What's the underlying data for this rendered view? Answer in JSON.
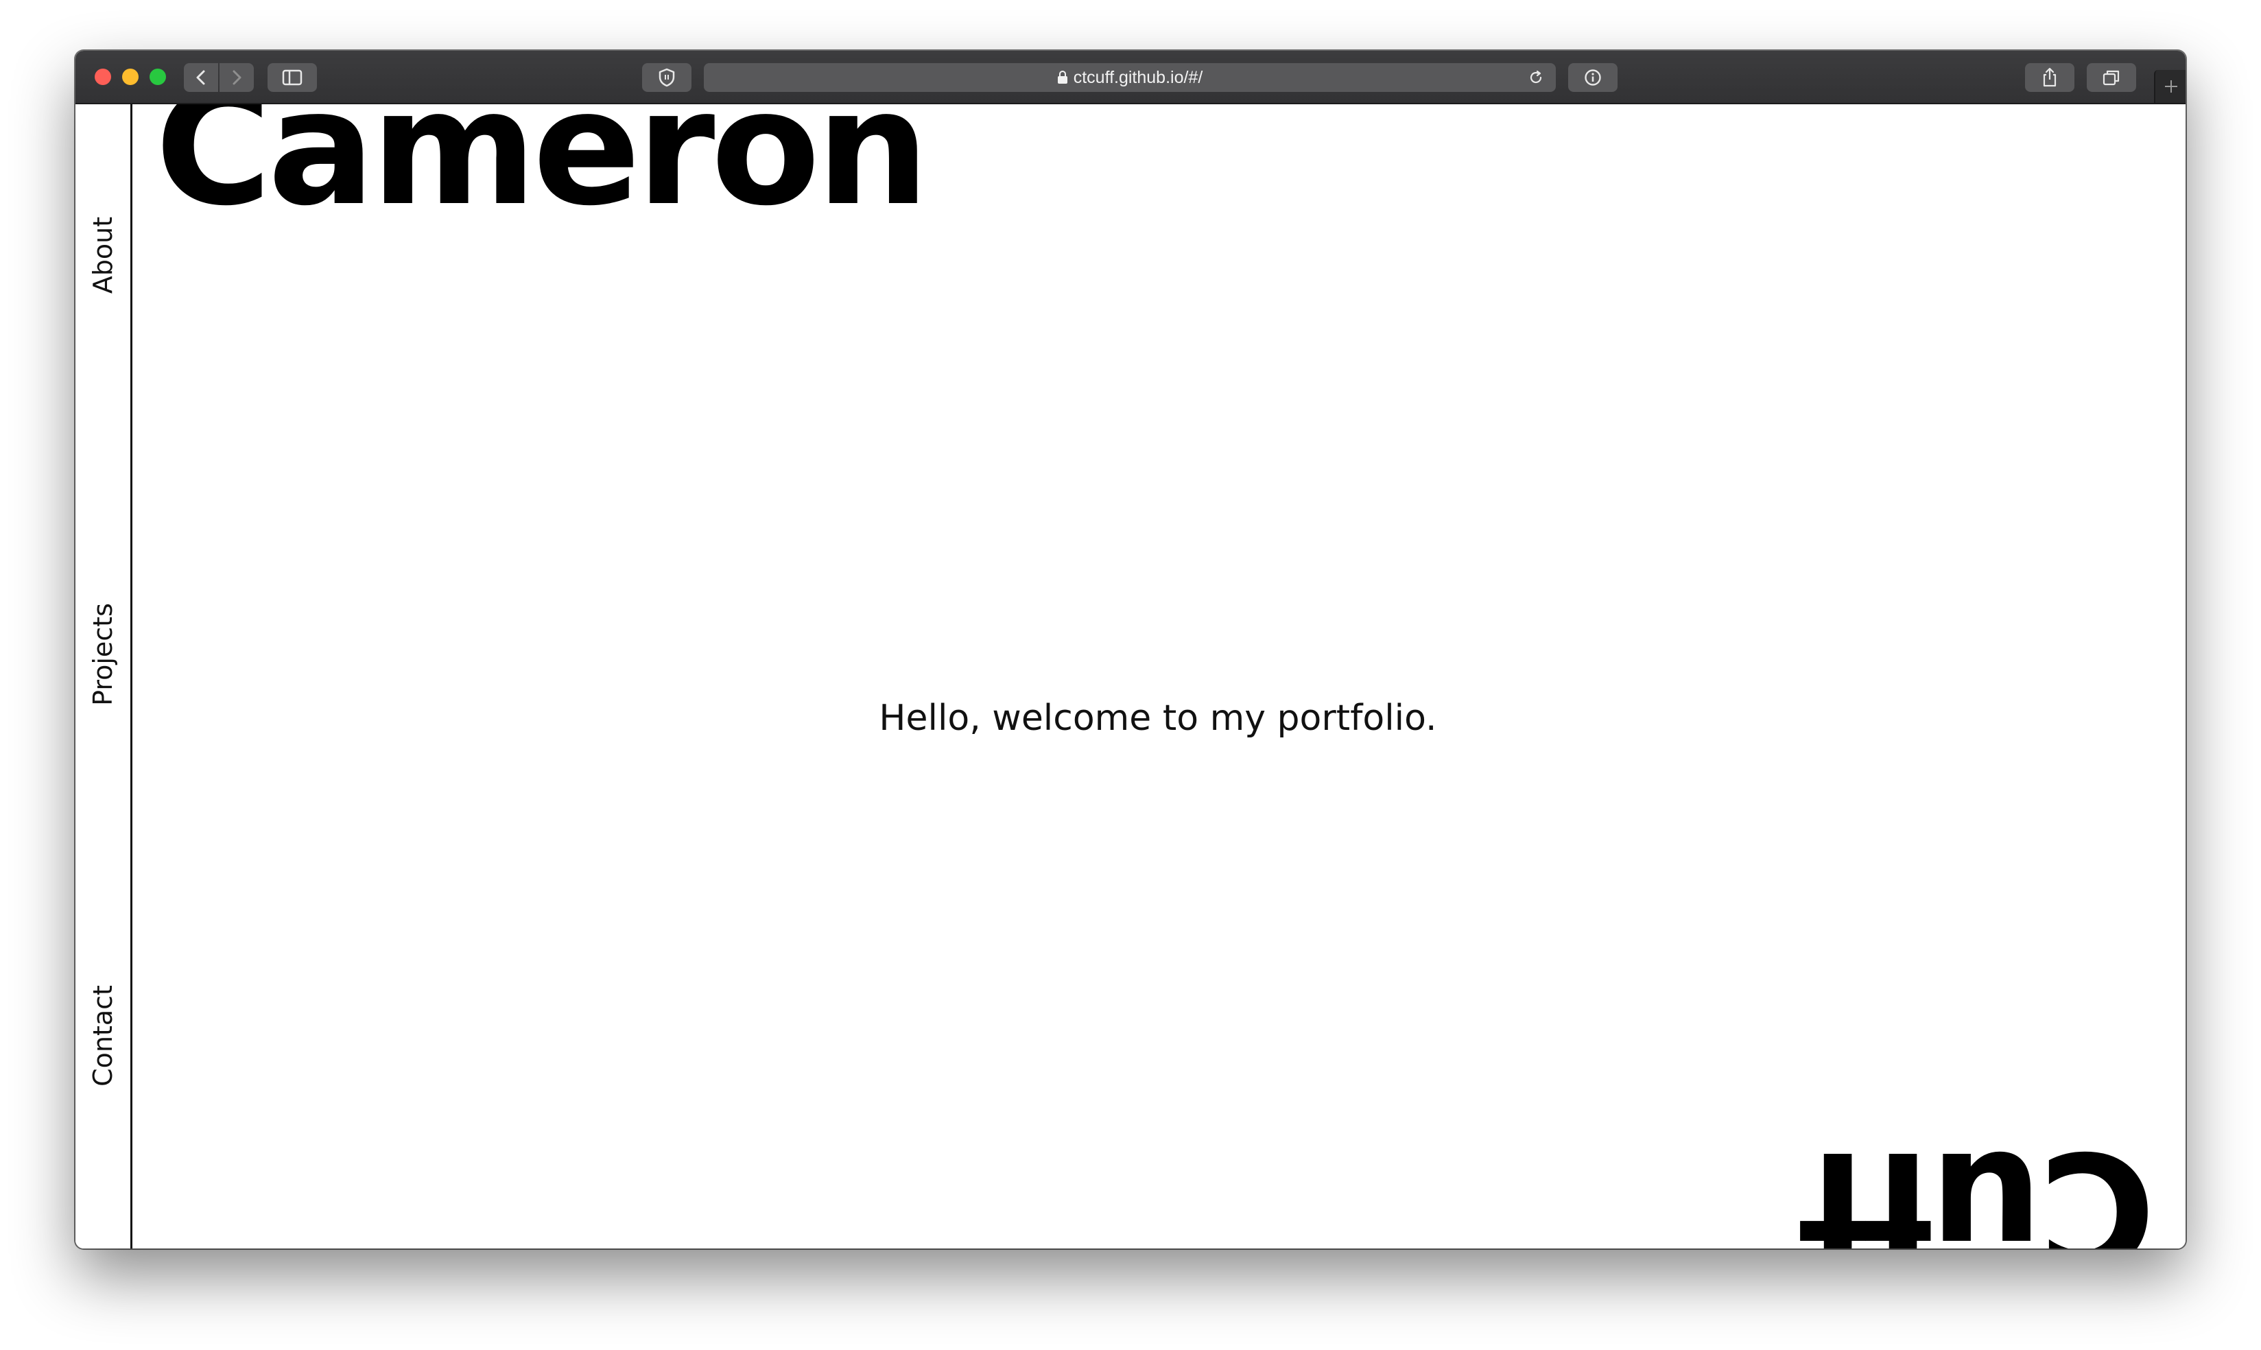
{
  "browser": {
    "url": "ctcuff.github.io/#/",
    "icons": {
      "back": "chevron-left-icon",
      "forward": "chevron-right-icon",
      "sidebar": "sidebar-icon",
      "shield": "shield-icon",
      "lock": "lock-icon",
      "reload": "reload-icon",
      "info": "info-icon",
      "share": "share-icon",
      "tabs": "tabs-icon",
      "new_tab": "plus-icon"
    },
    "colors": {
      "close": "#fe5f57",
      "minimize": "#febc2e",
      "zoom": "#28c840",
      "toolbar": "#3a3a3c"
    }
  },
  "sidebar": {
    "items": [
      {
        "label": "About"
      },
      {
        "label": "Projects"
      },
      {
        "label": "Contact"
      }
    ]
  },
  "header": {
    "first_name": "Cameron",
    "last_name": "Cuff"
  },
  "main": {
    "welcome_text": "Hello, welcome to my portfolio."
  }
}
